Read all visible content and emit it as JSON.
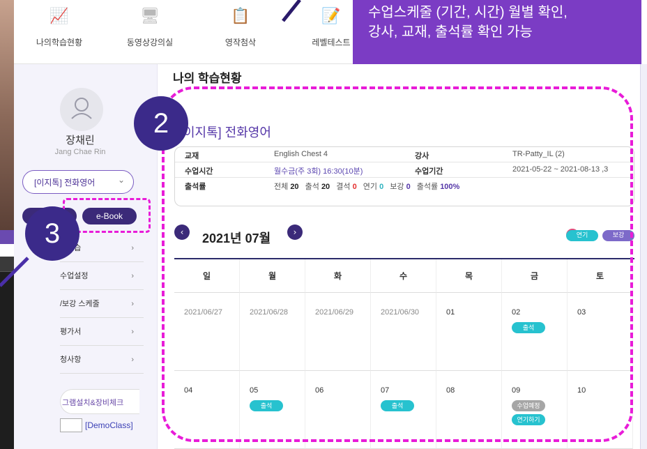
{
  "nav": {
    "items": [
      {
        "label": "나의학습현황"
      },
      {
        "label": "동영상강의실"
      },
      {
        "label": "영작첨삭"
      },
      {
        "label": "레벨테스트"
      }
    ]
  },
  "annotation": {
    "box_line1": "수업스케줄 (기간, 시간) 월별 확인,",
    "box_line2": "강사, 교재, 출석률 확인 가능",
    "step2": "2",
    "step3": "3"
  },
  "profile": {
    "name": "장채린",
    "name_en": "Jang Chae Rin",
    "course_select": "[이지톡] 전화영어"
  },
  "sidebar": {
    "ebook_label": "e-Book",
    "menu": [
      {
        "label": "예복습"
      },
      {
        "label": "수업설정"
      },
      {
        "label": "/보강 스케줄"
      },
      {
        "label": "평가서"
      },
      {
        "label": "청사항"
      }
    ],
    "install_label": "그램설치&장비체크",
    "demo_label": "[DemoClass]"
  },
  "main": {
    "title": "나의 학습현황",
    "course_title": "[이지톡] 전화영어",
    "info": {
      "textbook_k": "교재",
      "textbook_v": "English Chest 4",
      "teacher_k": "강사",
      "teacher_v": "TR-Patty_IL (2)",
      "time_k": "수업시간",
      "time_v": "월수금(주 3회) 16:30(10분)",
      "period_k": "수업기간",
      "period_v": "2021-05-22 ~ 2021-08-13 ,3",
      "attend_k": "출석률",
      "stats": {
        "total_l": "전체",
        "total_v": "20",
        "present_l": "출석",
        "present_v": "20",
        "absent_l": "결석",
        "absent_v": "0",
        "postpone_l": "연기",
        "postpone_v": "0",
        "makeup_l": "보강",
        "makeup_v": "0",
        "rate_l": "출석률",
        "rate_v": "100%"
      }
    }
  },
  "calendar": {
    "month_label": "2021년 07월",
    "prev_icon": "‹",
    "next_icon": "›",
    "legend_postpone": "연기",
    "legend_makeup": "보강",
    "weekdays": [
      "일",
      "월",
      "화",
      "수",
      "목",
      "금",
      "토"
    ],
    "week1": [
      "2021/06/27",
      "2021/06/28",
      "2021/06/29",
      "2021/06/30",
      "01",
      "02",
      "03"
    ],
    "week2": [
      "04",
      "05",
      "06",
      "07",
      "08",
      "09",
      "10"
    ],
    "badge_attend": "출석",
    "badge_scheduled": "수업예정",
    "badge_postpone_action": "연기하기"
  }
}
